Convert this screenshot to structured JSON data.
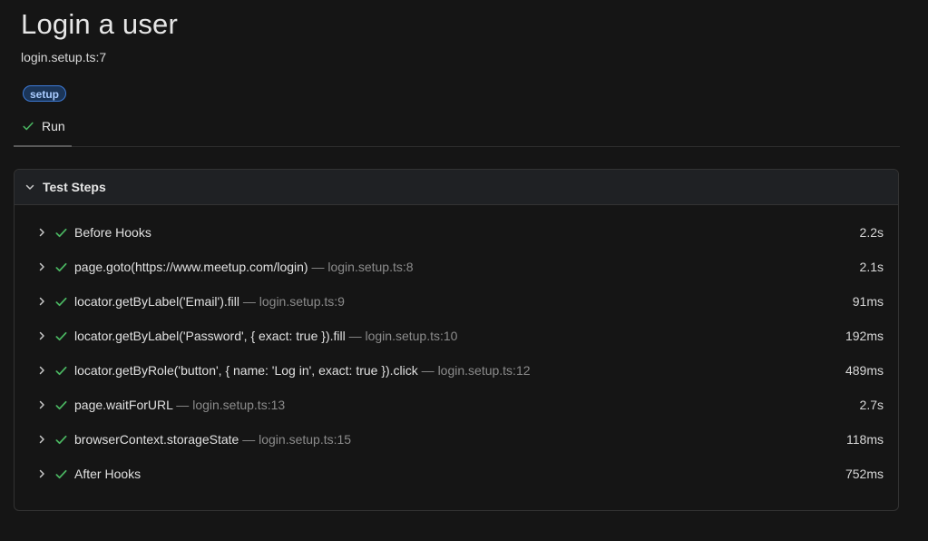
{
  "header": {
    "title": "Login a user",
    "location": "login.setup.ts:7",
    "tag": "setup"
  },
  "tabs": [
    {
      "label": "Run",
      "icon": "check-icon",
      "status": "passed"
    }
  ],
  "steps_panel": {
    "title": "Test Steps",
    "expanded": true
  },
  "steps": [
    {
      "title": "Before Hooks",
      "location": "",
      "duration": "2.2s"
    },
    {
      "title": "page.goto(https://www.meetup.com/login)",
      "location": "login.setup.ts:8",
      "duration": "2.1s"
    },
    {
      "title": "locator.getByLabel('Email').fill",
      "location": "login.setup.ts:9",
      "duration": "91ms"
    },
    {
      "title": "locator.getByLabel('Password', { exact: true }).fill",
      "location": "login.setup.ts:10",
      "duration": "192ms"
    },
    {
      "title": "locator.getByRole('button', { name: 'Log in', exact: true }).click",
      "location": "login.setup.ts:12",
      "duration": "489ms"
    },
    {
      "title": "page.waitForURL",
      "location": "login.setup.ts:13",
      "duration": "2.7s"
    },
    {
      "title": "browserContext.storageState",
      "location": "login.setup.ts:15",
      "duration": "118ms"
    },
    {
      "title": "After Hooks",
      "location": "",
      "duration": "752ms"
    }
  ],
  "colors": {
    "background": "#151515",
    "success": "#4ab561",
    "tag_border": "#3d7ad6",
    "tag_text": "#a9cbff",
    "muted_text": "#8b8b8b"
  }
}
